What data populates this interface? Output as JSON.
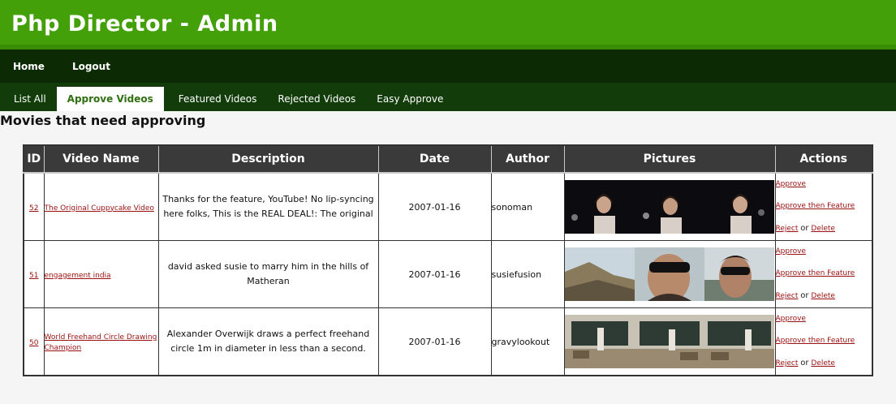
{
  "header": {
    "title": "Php Director - Admin"
  },
  "topnav": {
    "home": "Home",
    "logout": "Logout"
  },
  "tabs": [
    "List All",
    "Approve Videos",
    "Featured Videos",
    "Rejected Videos",
    "Easy Approve"
  ],
  "page": {
    "heading": "Movies that need approving"
  },
  "table": {
    "columns": [
      "ID",
      "Video Name",
      "Description",
      "Date",
      "Author",
      "Pictures",
      "Actions"
    ],
    "rows": [
      {
        "id": "52",
        "name": "The Original Cuppycake Video",
        "desc_line1": "Thanks for the feature, YouTube! No lip-syncing",
        "desc_line2": "here folks, This is the REAL DEAL!: The original",
        "date": "2007-01-16",
        "author": "sonoman"
      },
      {
        "id": "51",
        "name": "engagement india",
        "desc_line1": "david asked susie to marry him in the hills of",
        "desc_line2": "Matheran",
        "date": "2007-01-16",
        "author": "susiefusion"
      },
      {
        "id": "50",
        "name": "World Freehand Circle Drawing Champion",
        "desc_line1": "Alexander Overwijk draws a perfect freehand",
        "desc_line2": "circle 1m in diameter in less than a second.",
        "date": "2007-01-16",
        "author": "gravylookout"
      }
    ],
    "actions": {
      "approve": "Approve",
      "approve_feature": "Approve then Feature",
      "reject": "Reject",
      "or": "or",
      "delete": "Delete"
    }
  },
  "colors": {
    "header": "#43a009",
    "topnav": "#0c2a04",
    "tabs": "#123d0a",
    "link": "#9b1010"
  }
}
